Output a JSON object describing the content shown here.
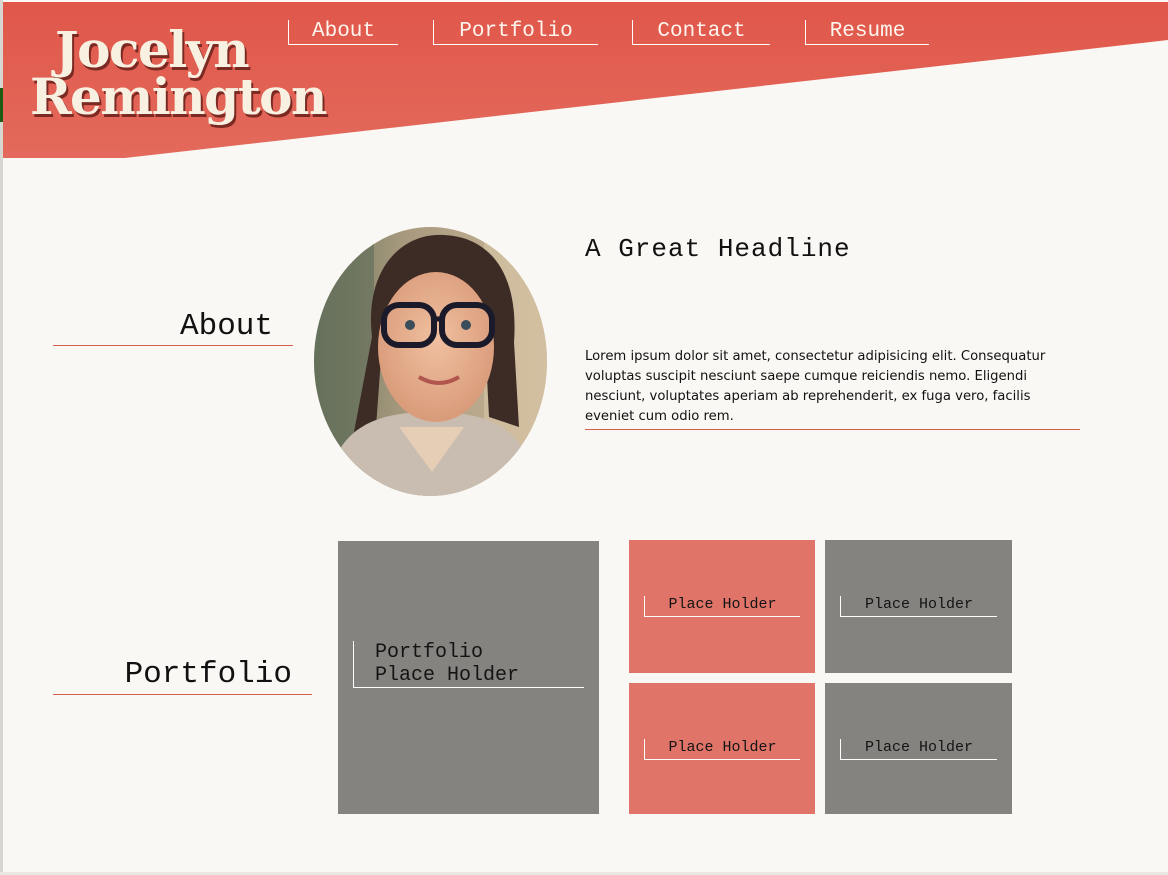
{
  "site": {
    "logo_line1": "Jocelyn",
    "logo_line2": "Remington"
  },
  "nav": {
    "items": [
      {
        "label": "About"
      },
      {
        "label": "Portfolio"
      },
      {
        "label": "Contact"
      },
      {
        "label": "Resume"
      }
    ]
  },
  "about": {
    "section_label": "About",
    "headline": "A Great Headline",
    "body": "Lorem ipsum dolor sit amet, consectetur adipisicing elit. Consequatur voluptas suscipit nesciunt saepe cumque reiciendis nemo. Eligendi nesciunt, voluptates aperiam ab reprehenderit, ex fuga vero, facilis eveniet cum odio rem."
  },
  "portfolio": {
    "section_label": "Portfolio",
    "main_tile_line1": "Portfolio",
    "main_tile_line2": "Place Holder",
    "tiles": [
      {
        "label": "Place Holder"
      },
      {
        "label": "Place Holder"
      },
      {
        "label": "Place Holder"
      },
      {
        "label": "Place Holder"
      }
    ]
  },
  "colors": {
    "accent": "#e0574a",
    "tile_coral": "#e07468",
    "tile_gray": "#85837f",
    "background": "#faf8f4",
    "logo_text": "#f8f1e2"
  }
}
